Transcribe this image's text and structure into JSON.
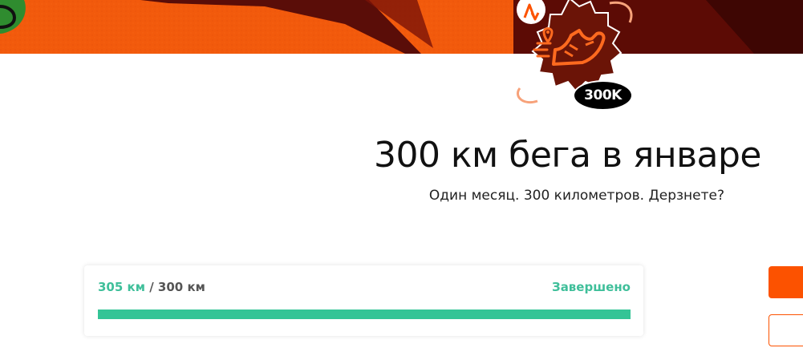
{
  "badge": {
    "label": "300K",
    "icons": [
      "strava-logo-icon",
      "location-pin-icon",
      "running-shoe-icon"
    ]
  },
  "challenge": {
    "title": "300 км бега в январе",
    "subtitle": "Один месяц. 300 километров. Дерзнете?"
  },
  "progress": {
    "current": "305 км",
    "separator": " / ",
    "goal": "300 км",
    "status": "Завершено",
    "fraction": 1.0
  },
  "colors": {
    "brand": "#fc5200",
    "success": "#34c496",
    "badge_fill": "#6b1407"
  }
}
